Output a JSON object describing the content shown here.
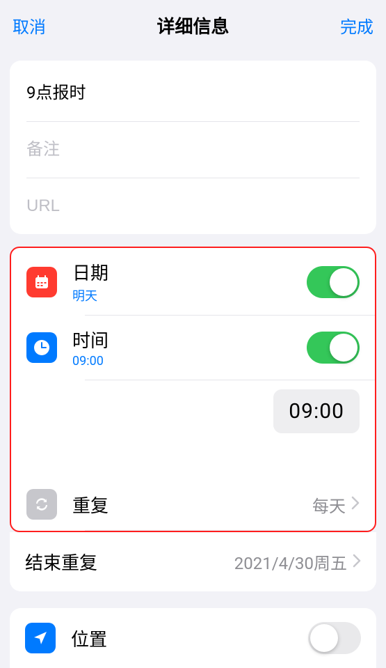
{
  "header": {
    "cancel": "取消",
    "title": "详细信息",
    "done": "完成"
  },
  "fields": {
    "title_value": "9点报时",
    "notes_placeholder": "备注",
    "url_placeholder": "URL"
  },
  "date": {
    "label": "日期",
    "sub": "明天",
    "on": true
  },
  "time": {
    "label": "时间",
    "sub": "09:00",
    "on": true,
    "picker_value": "09:00"
  },
  "repeat": {
    "label": "重复",
    "value": "每天"
  },
  "end_repeat": {
    "label": "结束重复",
    "value": "2021/4/30周五"
  },
  "location": {
    "label": "位置",
    "on": false
  }
}
